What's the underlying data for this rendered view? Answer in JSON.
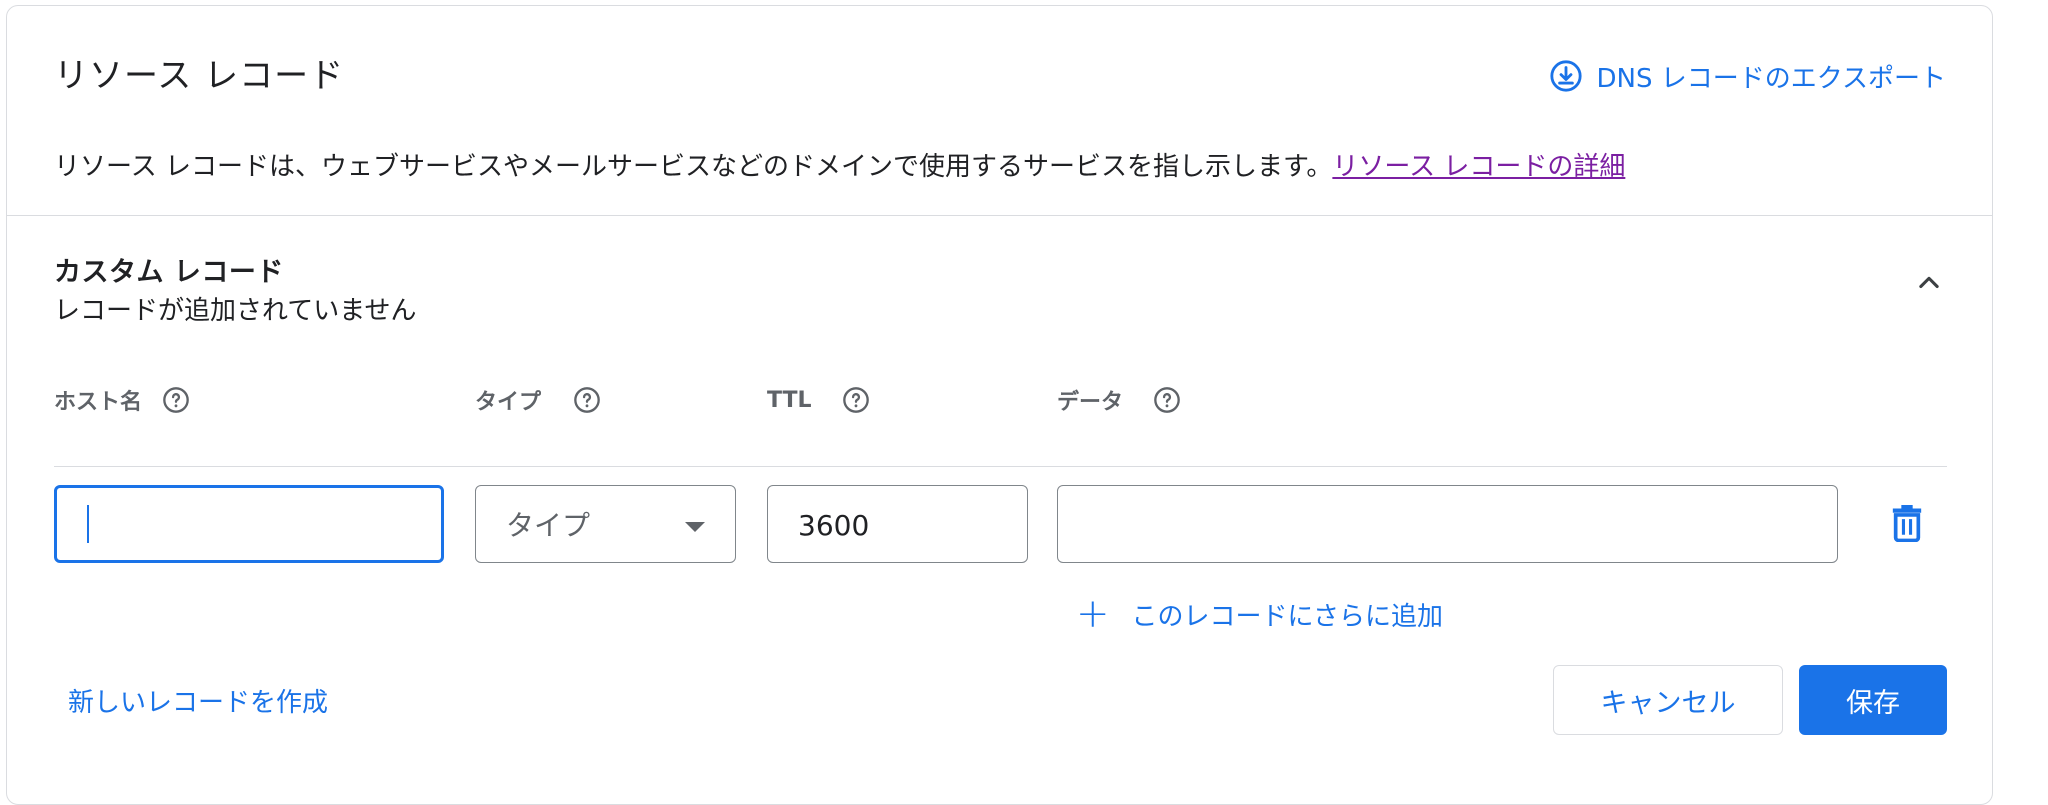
{
  "header": {
    "title": "リソース レコード",
    "export_label": "DNS レコードのエクスポート"
  },
  "description": {
    "text": "リソース レコードは、ウェブサービスやメールサービスなどのドメインで使用するサービスを指し示します。",
    "link": "リソース レコードの詳細"
  },
  "custom_records": {
    "title": "カスタム レコード",
    "subtitle": "レコードが追加されていません"
  },
  "columns": {
    "host": "ホスト名",
    "type": "タイプ",
    "ttl": "TTL",
    "data": "データ"
  },
  "row": {
    "host_value": "",
    "type_placeholder": "タイプ",
    "ttl_value": "3600",
    "data_value": ""
  },
  "actions": {
    "add_more": "このレコードにさらに追加",
    "new_record": "新しいレコードを作成",
    "cancel": "キャンセル",
    "save": "保存"
  },
  "colors": {
    "accent": "#1a73e8",
    "link_visited": "#7b1fa2",
    "border": "#dadce0"
  },
  "icons": {
    "export": "download-circle-icon",
    "collapse": "chevron-up-icon",
    "help": "help-circle-icon",
    "delete": "trash-icon",
    "add": "plus-icon"
  }
}
